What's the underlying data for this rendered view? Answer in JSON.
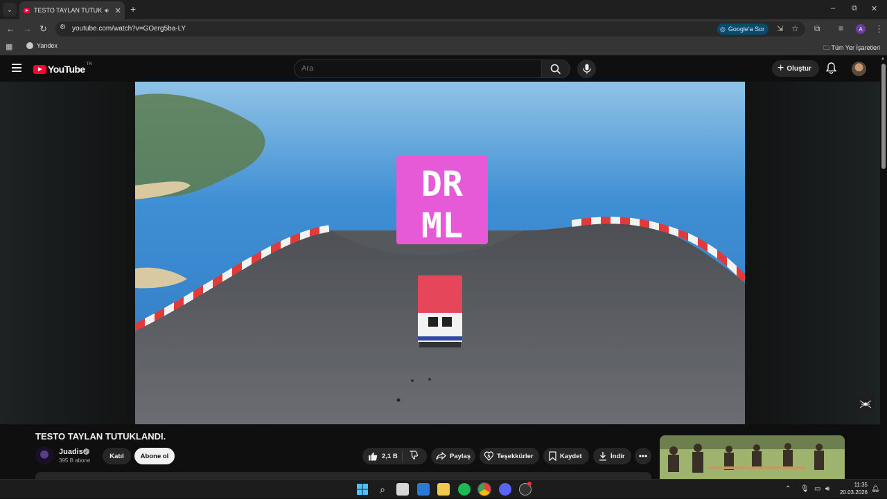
{
  "browser": {
    "tab_title": "TESTO TAYLAN TUTUKLANDI.",
    "url": "youtube.com/watch?v=GOerg5ba-LY",
    "google_sor_label": "Google'a Sor",
    "profile_initial": "A",
    "bookmarks": {
      "yandex": "Yandex",
      "all_bookmarks": "Tüm Yer İşaretleri"
    },
    "window_controls": {
      "minimize": "–",
      "restore": "⧉",
      "close": "✕"
    }
  },
  "youtube": {
    "logo_text": "YouTube",
    "country_code": "TR",
    "search_placeholder": "Ara",
    "create_label": "Oluştur",
    "video": {
      "sign_text_line1": "DR",
      "sign_text_line2": "ML"
    },
    "title": "TESTO TAYLAN TUTUKLANDI.",
    "channel": {
      "name": "Juadis",
      "subscribers": "395 B abone"
    },
    "buttons": {
      "join": "Katıl",
      "subscribe": "Abone ol",
      "likes": "2,1 B",
      "share": "Paylaş",
      "thanks": "Teşekkürler",
      "save": "Kaydet",
      "download": "İndir",
      "more": "•••"
    }
  },
  "taskbar": {
    "time": "11:35",
    "date": "20.03.2026"
  },
  "colors": {
    "yt_red": "#ff0033",
    "bg": "#0f0f0f",
    "pill": "#272727",
    "sign_magenta": "#e65ad8"
  }
}
